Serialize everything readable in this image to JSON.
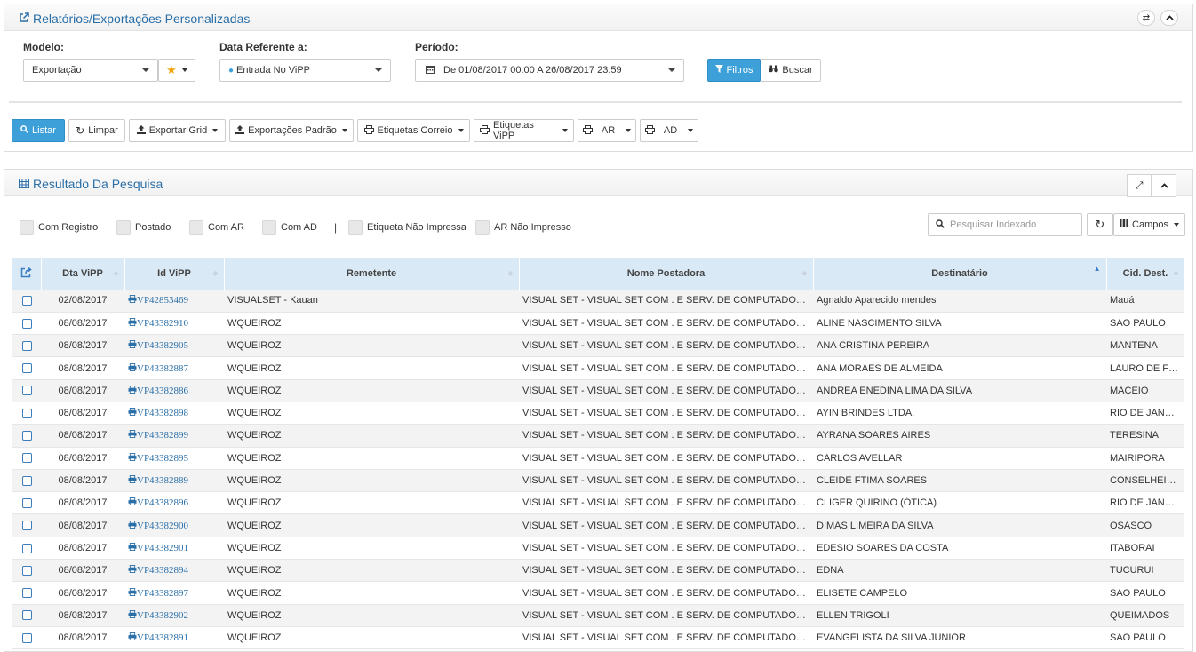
{
  "top_panel": {
    "title": "Relatórios/Exportações Personalizadas",
    "title_icon": "external-link-icon",
    "tools": [
      "shuffle-icon",
      "chevron-up-icon"
    ]
  },
  "filters": {
    "modelo_label": "Modelo:",
    "modelo_value": "Exportação",
    "data_ref_label": "Data Referente a:",
    "data_ref_value": "Entrada No ViPP",
    "periodo_label": "Período:",
    "periodo_value": "De 01/08/2017 00:00 A 26/08/2017 23:59",
    "filtros_btn": "Filtros",
    "buscar_btn": "Buscar"
  },
  "toolbar": {
    "listar": "Listar",
    "limpar": "Limpar",
    "exportar_grid": "Exportar Grid",
    "exportacoes_padrao": "Exportações Padrão",
    "etiquetas_correio": "Etiquetas Correio",
    "etiquetas_vipp": "Etiquetas ViPP",
    "ar": "AR",
    "ad": "AD"
  },
  "result_panel": {
    "title": "Resultado Da Pesquisa",
    "title_icon": "table-icon",
    "tools": [
      "expand-icon",
      "chevron-up-icon"
    ]
  },
  "checkbox_filters": {
    "com_registro": "Com Registro",
    "postado": "Postado",
    "com_ar": "Com AR",
    "com_ad": "Com AD",
    "separator": "|",
    "etiqueta_nao_impressa": "Etiqueta Não Impressa",
    "ar_nao_impresso": "AR Não Impresso"
  },
  "search": {
    "placeholder": "Pesquisar Indexado",
    "campos_btn": "Campos"
  },
  "table": {
    "headers": {
      "dta_vipp": "Dta ViPP",
      "id_vipp": "Id ViPP",
      "remetente": "Remetente",
      "nome_postadora": "Nome Postadora",
      "destinatario": "Destinatário",
      "cid_dest": "Cid. Dest."
    },
    "rows": [
      {
        "dta": "02/08/2017",
        "id": "VP42853469",
        "remetente": "VISUALSET - Kauan",
        "postadora": "VISUAL SET - VISUAL SET COM . E SERV. DE COMPUTADORES",
        "destinatario": "Agnaldo Aparecido mendes",
        "cidade": "Mauá"
      },
      {
        "dta": "08/08/2017",
        "id": "VP43382910",
        "remetente": "WQUEIROZ",
        "postadora": "VISUAL SET - VISUAL SET COM . E SERV. DE COMPUTADORES",
        "destinatario": "ALINE NASCIMENTO SILVA",
        "cidade": "SAO PAULO"
      },
      {
        "dta": "08/08/2017",
        "id": "VP43382905",
        "remetente": "WQUEIROZ",
        "postadora": "VISUAL SET - VISUAL SET COM . E SERV. DE COMPUTADORES",
        "destinatario": "ANA CRISTINA PEREIRA",
        "cidade": "MANTENA"
      },
      {
        "dta": "08/08/2017",
        "id": "VP43382887",
        "remetente": "WQUEIROZ",
        "postadora": "VISUAL SET - VISUAL SET COM . E SERV. DE COMPUTADORES",
        "destinatario": "ANA MORAES DE ALMEIDA",
        "cidade": "LAURO DE FREITAS"
      },
      {
        "dta": "08/08/2017",
        "id": "VP43382886",
        "remetente": "WQUEIROZ",
        "postadora": "VISUAL SET - VISUAL SET COM . E SERV. DE COMPUTADORES",
        "destinatario": "ANDREA ENEDINA LIMA DA SILVA",
        "cidade": "MACEIO"
      },
      {
        "dta": "08/08/2017",
        "id": "VP43382898",
        "remetente": "WQUEIROZ",
        "postadora": "VISUAL SET - VISUAL SET COM . E SERV. DE COMPUTADORES",
        "destinatario": "AYIN BRINDES LTDA.",
        "cidade": "RIO DE JANEIRO"
      },
      {
        "dta": "08/08/2017",
        "id": "VP43382899",
        "remetente": "WQUEIROZ",
        "postadora": "VISUAL SET - VISUAL SET COM . E SERV. DE COMPUTADORES",
        "destinatario": "AYRANA SOARES AIRES",
        "cidade": "TERESINA"
      },
      {
        "dta": "08/08/2017",
        "id": "VP43382895",
        "remetente": "WQUEIROZ",
        "postadora": "VISUAL SET - VISUAL SET COM . E SERV. DE COMPUTADORES",
        "destinatario": "CARLOS AVELLAR",
        "cidade": "MAIRIPORA"
      },
      {
        "dta": "08/08/2017",
        "id": "VP43382889",
        "remetente": "WQUEIROZ",
        "postadora": "VISUAL SET - VISUAL SET COM . E SERV. DE COMPUTADORES",
        "destinatario": "CLEIDE FTIMA SOARES",
        "cidade": "CONSELHEIRO LAFAIETE"
      },
      {
        "dta": "08/08/2017",
        "id": "VP43382896",
        "remetente": "WQUEIROZ",
        "postadora": "VISUAL SET - VISUAL SET COM . E SERV. DE COMPUTADORES",
        "destinatario": "CLIGER QUIRINO (ÓTICA)",
        "cidade": "RIO DE JANEIRO"
      },
      {
        "dta": "08/08/2017",
        "id": "VP43382900",
        "remetente": "WQUEIROZ",
        "postadora": "VISUAL SET - VISUAL SET COM . E SERV. DE COMPUTADORES",
        "destinatario": "DIMAS LIMEIRA DA SILVA",
        "cidade": "OSASCO"
      },
      {
        "dta": "08/08/2017",
        "id": "VP43382901",
        "remetente": "WQUEIROZ",
        "postadora": "VISUAL SET - VISUAL SET COM . E SERV. DE COMPUTADORES",
        "destinatario": "EDESIO SOARES DA COSTA",
        "cidade": "ITABORAI"
      },
      {
        "dta": "08/08/2017",
        "id": "VP43382894",
        "remetente": "WQUEIROZ",
        "postadora": "VISUAL SET - VISUAL SET COM . E SERV. DE COMPUTADORES",
        "destinatario": "EDNA",
        "cidade": "TUCURUI"
      },
      {
        "dta": "08/08/2017",
        "id": "VP43382897",
        "remetente": "WQUEIROZ",
        "postadora": "VISUAL SET - VISUAL SET COM . E SERV. DE COMPUTADORES",
        "destinatario": "ELISETE CAMPELO",
        "cidade": "SAO PAULO"
      },
      {
        "dta": "08/08/2017",
        "id": "VP43382902",
        "remetente": "WQUEIROZ",
        "postadora": "VISUAL SET - VISUAL SET COM . E SERV. DE COMPUTADORES",
        "destinatario": "ELLEN TRIGOLI",
        "cidade": "QUEIMADOS"
      },
      {
        "dta": "08/08/2017",
        "id": "VP43382891",
        "remetente": "WQUEIROZ",
        "postadora": "VISUAL SET - VISUAL SET COM . E SERV. DE COMPUTADORES",
        "destinatario": "EVANGELISTA DA SILVA JUNIOR",
        "cidade": "SAO PAULO"
      }
    ]
  },
  "colors": {
    "accent": "#3da0d9",
    "title_blue": "#2a6fa8",
    "header_bg": "#d9e9f5",
    "star": "#f0a30a"
  }
}
